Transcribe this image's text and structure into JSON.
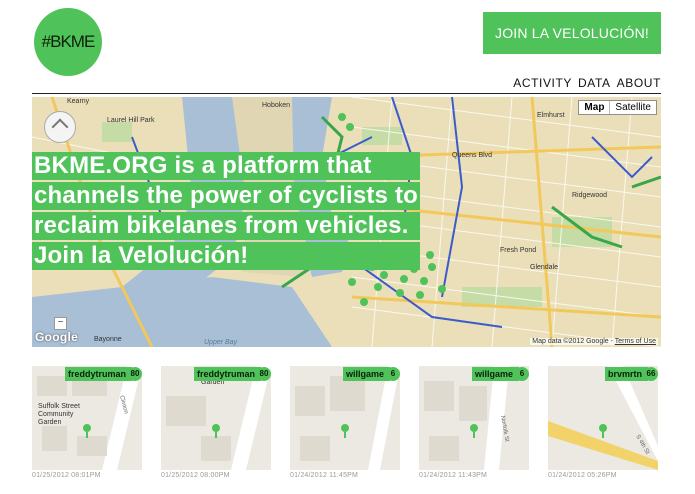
{
  "brand": {
    "logo_text": "#BKME"
  },
  "header": {
    "join_label": "JOIN LA VELOLUCIÓN!"
  },
  "nav": {
    "items": [
      "ACTIVITY",
      "DATA",
      "ABOUT"
    ]
  },
  "map": {
    "type_map": "Map",
    "type_satellite": "Satellite",
    "brand": "Google",
    "attribution": "Map data ©2012 Google -",
    "terms": "Terms of Use",
    "labels": [
      "Kearny",
      "Laurel Hill Park",
      "Hoboken",
      "Elmhurst",
      "Queens Blvd",
      "Ridgewood",
      "Fresh Pond",
      "Glendale",
      "Bayonne",
      "Upper Bay"
    ]
  },
  "hero": {
    "lines": [
      "BKME.ORG is a platform that",
      "channels the power of cyclists to",
      "reclaim bikelanes from vehicles.",
      "Join la Velolución!"
    ]
  },
  "cards": [
    {
      "user": "freddytruman",
      "count": "80",
      "time": "01/25/2012 08:01PM",
      "streets": [
        "Suffolk Street",
        "Community",
        "Garden",
        "Clinton"
      ]
    },
    {
      "user": "freddytruman",
      "count": "80",
      "time": "01/25/2012 08:00PM",
      "streets": [
        "Garden"
      ]
    },
    {
      "user": "willgame",
      "count": "6",
      "time": "01/24/2012 11:45PM",
      "streets": []
    },
    {
      "user": "willgame",
      "count": "6",
      "time": "01/24/2012 11:43PM",
      "streets": [
        "Norfolk St"
      ]
    },
    {
      "user": "brvmrtn",
      "count": "66",
      "time": "01/24/2012 05:26PM",
      "streets": [
        "S 4th St"
      ]
    }
  ],
  "colors": {
    "accent": "#4fc35a",
    "water": "#a9bfd6",
    "land": "#eadfb8"
  }
}
